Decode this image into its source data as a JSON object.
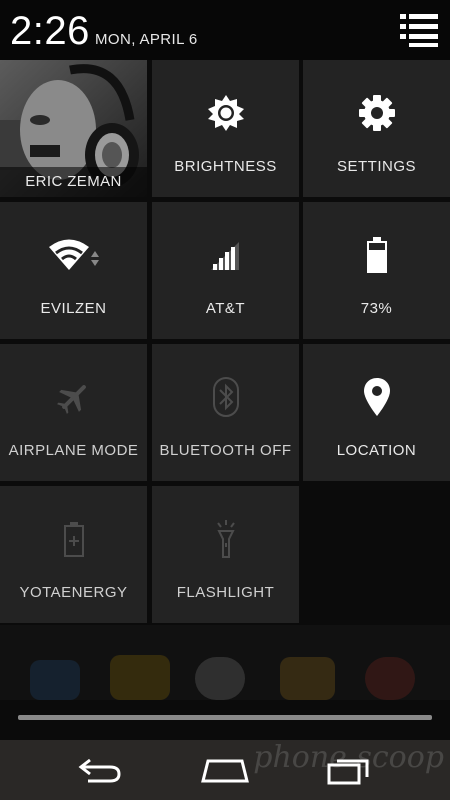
{
  "status": {
    "time": "2:26",
    "date": "MON, APRIL 6"
  },
  "header": {
    "menu_icon": "list-icon"
  },
  "tiles": [
    {
      "label": "ERIC ZEMAN",
      "icon": "user-photo"
    },
    {
      "label": "BRIGHTNESS",
      "icon": "brightness-icon"
    },
    {
      "label": "SETTINGS",
      "icon": "gear-icon"
    },
    {
      "label": "EVILZEN",
      "icon": "wifi-icon"
    },
    {
      "label": "AT&T",
      "icon": "signal-icon"
    },
    {
      "label": "73%",
      "icon": "battery-icon"
    },
    {
      "label": "AIRPLANE MODE",
      "icon": "airplane-icon"
    },
    {
      "label": "BLUETOOTH OFF",
      "icon": "bluetooth-icon"
    },
    {
      "label": "LOCATION",
      "icon": "location-pin-icon"
    },
    {
      "label": "YOTAENERGY",
      "icon": "battery-saver-icon"
    },
    {
      "label": "FLASHLIGHT",
      "icon": "flashlight-icon"
    }
  ],
  "navbar": {
    "back_icon": "back-icon",
    "home_icon": "home-icon",
    "recents_icon": "recents-icon"
  },
  "watermark": "phone scoop",
  "colors": {
    "tile_bg": "#232323",
    "header_bg": "#070707",
    "navbar_bg": "#2a2826"
  }
}
